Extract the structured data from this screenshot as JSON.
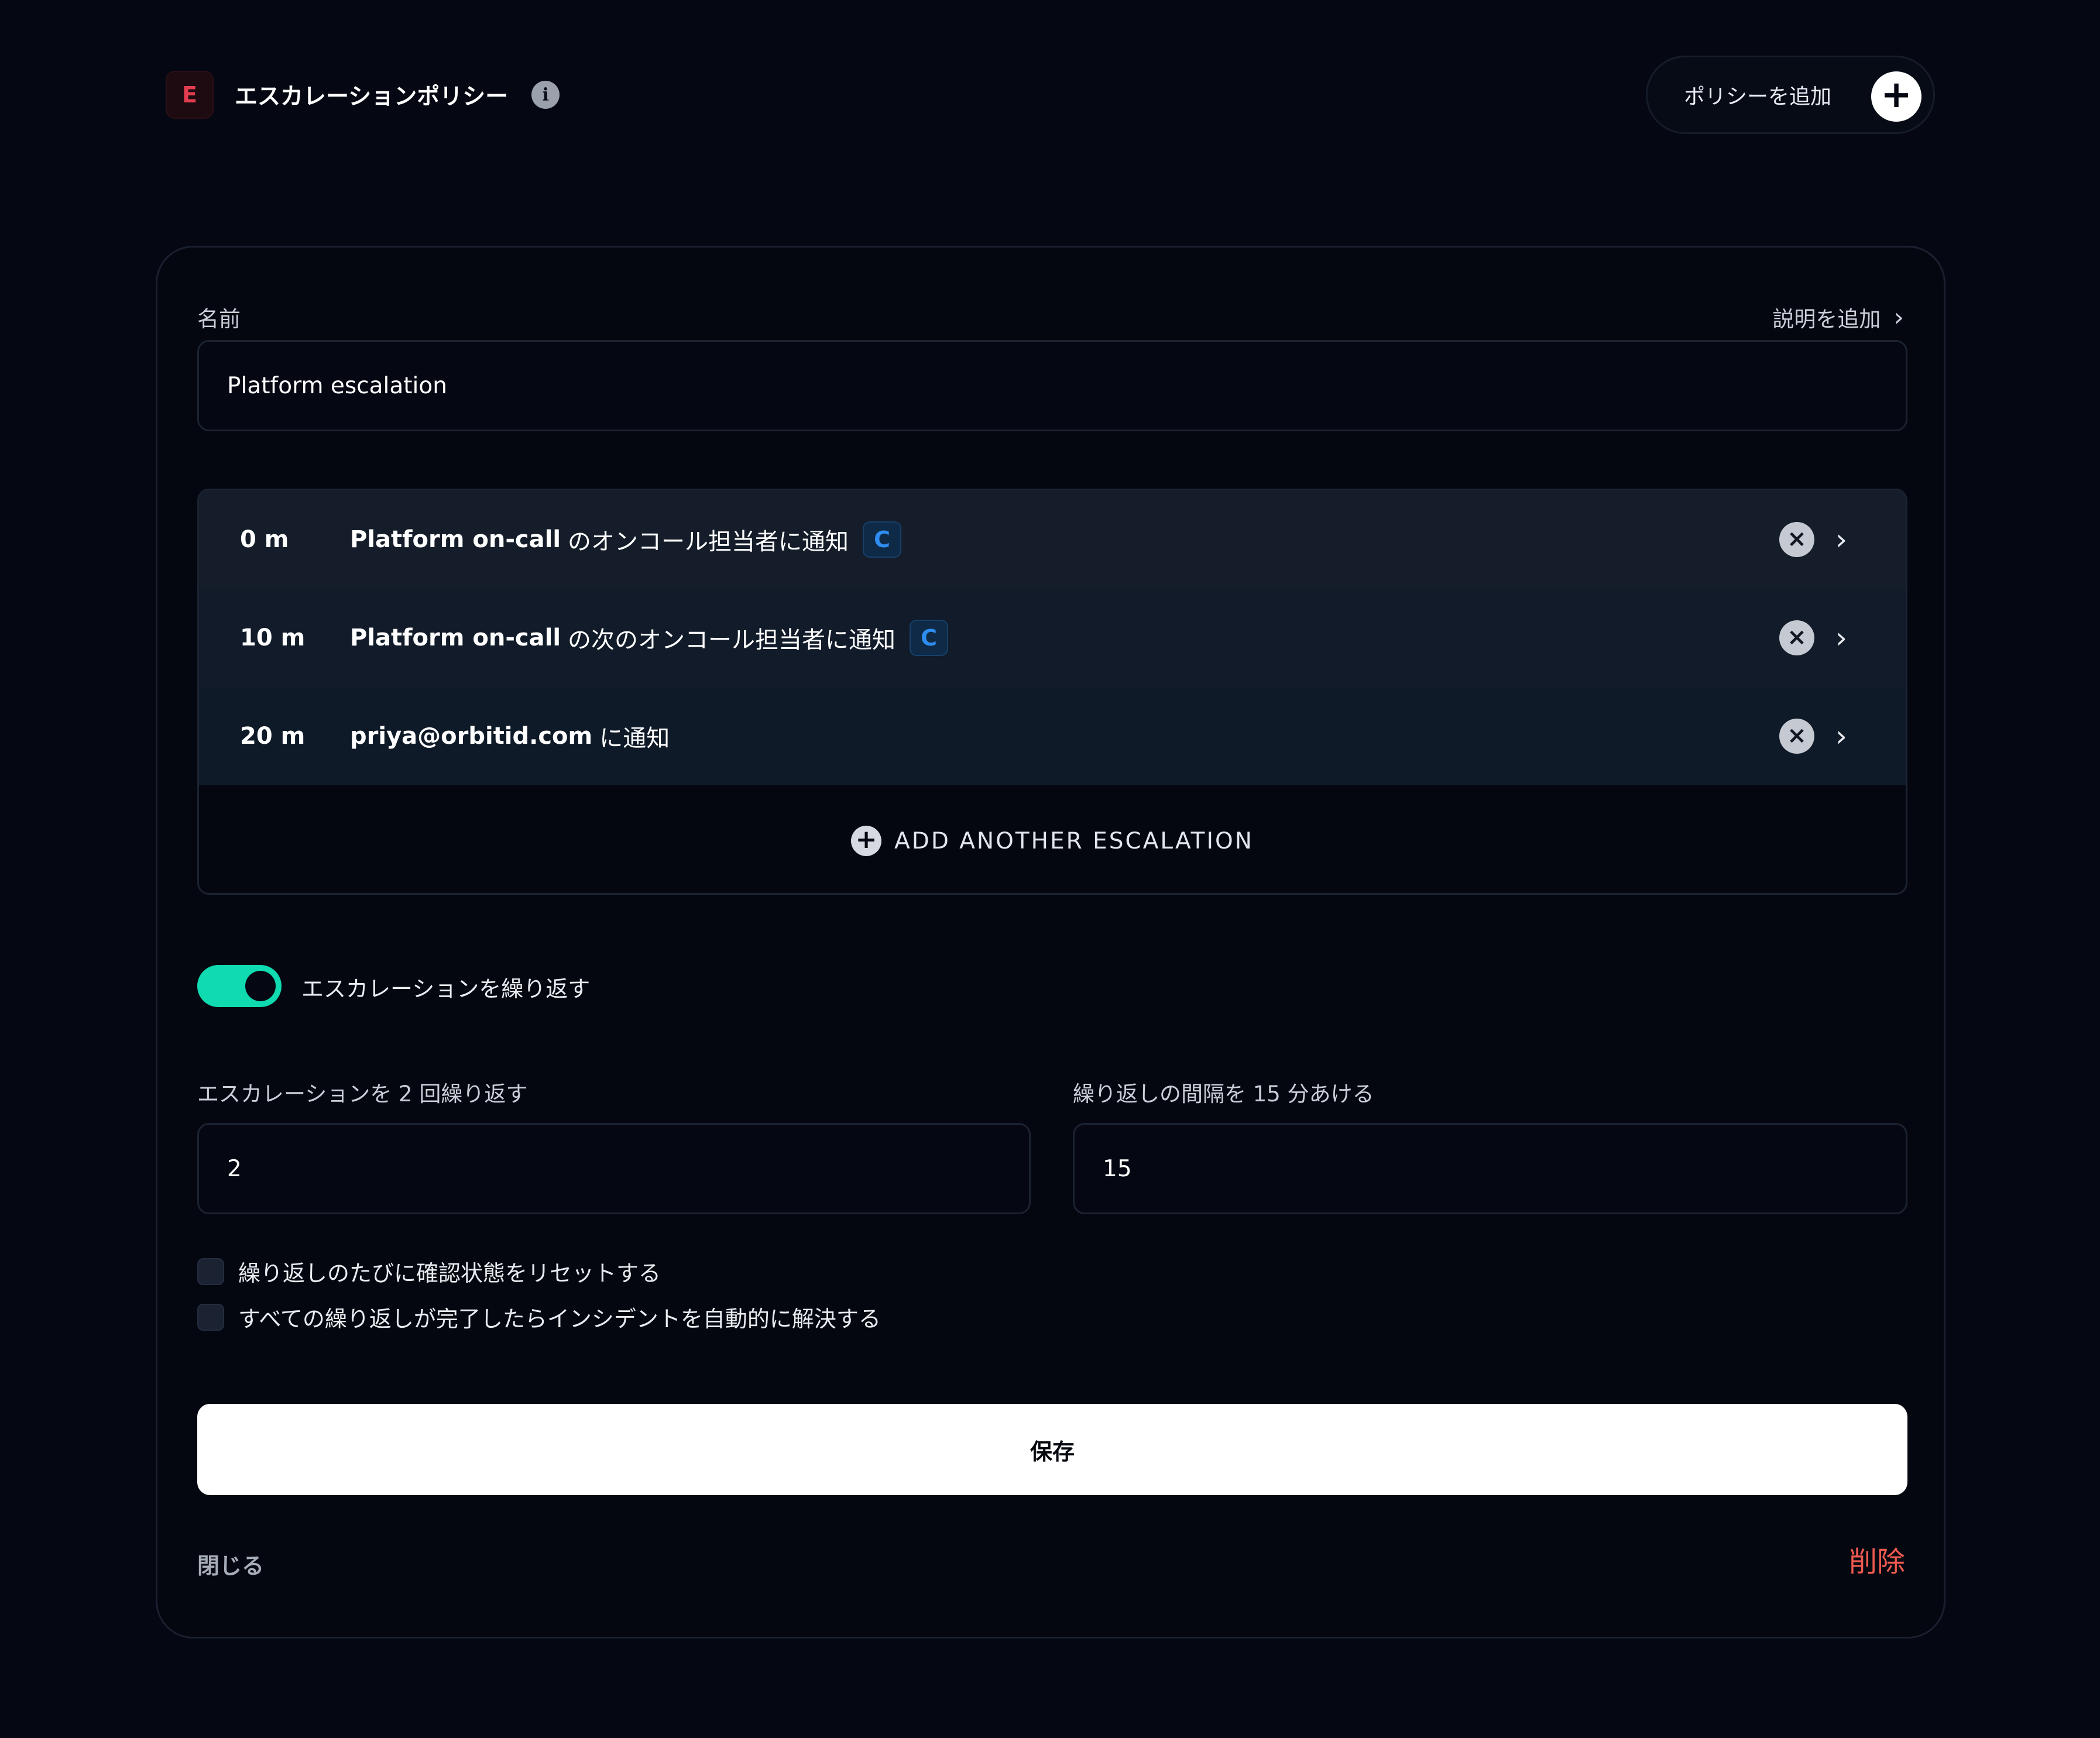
{
  "header": {
    "logo_letter": "E",
    "title": "エスカレーションポリシー",
    "info_icon": "i",
    "add_policy_label": "ポリシーを追加",
    "add_policy_icon": "+"
  },
  "form": {
    "name_label": "名前",
    "add_description": "説明を追加",
    "name_value": "Platform escalation",
    "escalations": [
      {
        "time": "0 m",
        "target": "Platform on-call",
        "action": "のオンコール担当者に通知",
        "badge": "C"
      },
      {
        "time": "10 m",
        "target": "Platform on-call",
        "action": "の次のオンコール担当者に通知",
        "badge": "C"
      },
      {
        "time": "20 m",
        "target": "priya@orbitid.com",
        "action": "に通知",
        "badge": ""
      }
    ],
    "add_another": "ADD ANOTHER ESCALATION",
    "repeat_toggle_label": "エスカレーションを繰り返す",
    "repeat_toggle_on": true,
    "repeat_count_label": "エスカレーションを 2 回繰り返す",
    "repeat_count_value": "2",
    "repeat_interval_label": "繰り返しの間隔を 15 分あける",
    "repeat_interval_value": "15",
    "checkbox_reset": "繰り返しのたびに確認状態をリセットする",
    "checkbox_resolve": "すべての繰り返しが完了したらインシデントを自動的に解決する",
    "save": "保存",
    "close": "閉じる",
    "delete": "削除"
  },
  "colors": {
    "background": "#050812",
    "accent_toggle": "#10dbb0",
    "badge_blue": "#2f8cf0",
    "danger": "#ef5a50",
    "logo_red": "#e23d50"
  }
}
